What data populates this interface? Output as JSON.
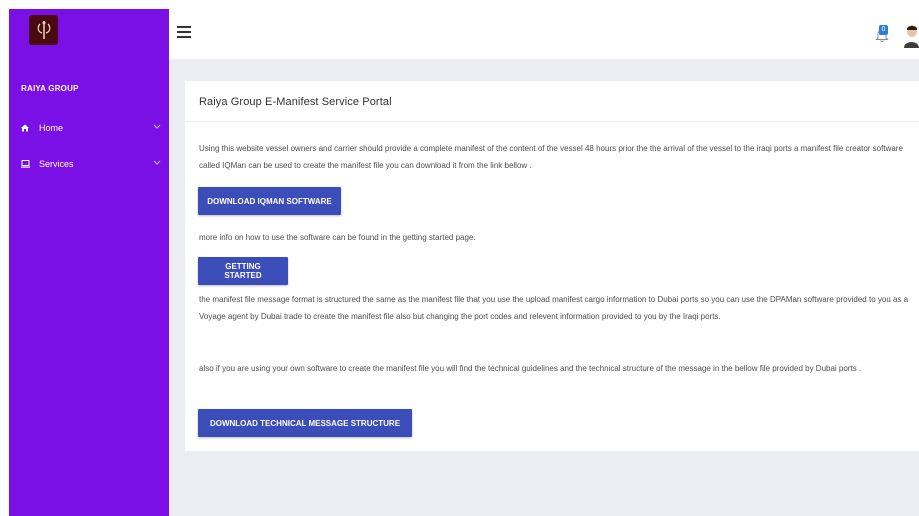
{
  "app": {
    "brand": "RAIYA GROUP"
  },
  "sidebar": {
    "items": [
      {
        "label": "Home",
        "icon": "home-icon"
      },
      {
        "label": "Services",
        "icon": "laptop-icon"
      }
    ]
  },
  "header": {
    "notification_count": "0"
  },
  "main": {
    "title": "Raiya Group E-Manifest Service Portal",
    "para1": "Using this website vessel owners and carrier should provide a complete manifest of the content of the vessel 48 hours prior the the arrival of the vessel to the iraqi ports a manifest file creator software called IQMan can be used to create the manifest file you can download it from the link bellow .",
    "download_iqman_label": "DOWNLOAD IQMAN SOFTWARE",
    "para2": "more info on how to use the software can be found in the getting started page.",
    "getting_started_label": "GETTING STARTED",
    "para3": "the manifest file message format is structured the same as the manifest file that you use the upload manifest cargo information to Dubai ports so you can use the DPAMan software provided to you as a Voyage agent by Dubai trade to create the manifest file also but changing the port codes and relevent information provided to you by the Iraqi ports.",
    "para4": "also if you are using your own software to create the manifest file you will find the technical guidelines and the technical structure of the message in the bellow file provided by Dubai ports .",
    "download_technical_label": "DOWNLOAD TECHNICAL MESSAGE STRUCTURE"
  },
  "colors": {
    "sidebar": "#7a10e6",
    "button": "#3b4db8",
    "content_background": "#ebedf2"
  }
}
